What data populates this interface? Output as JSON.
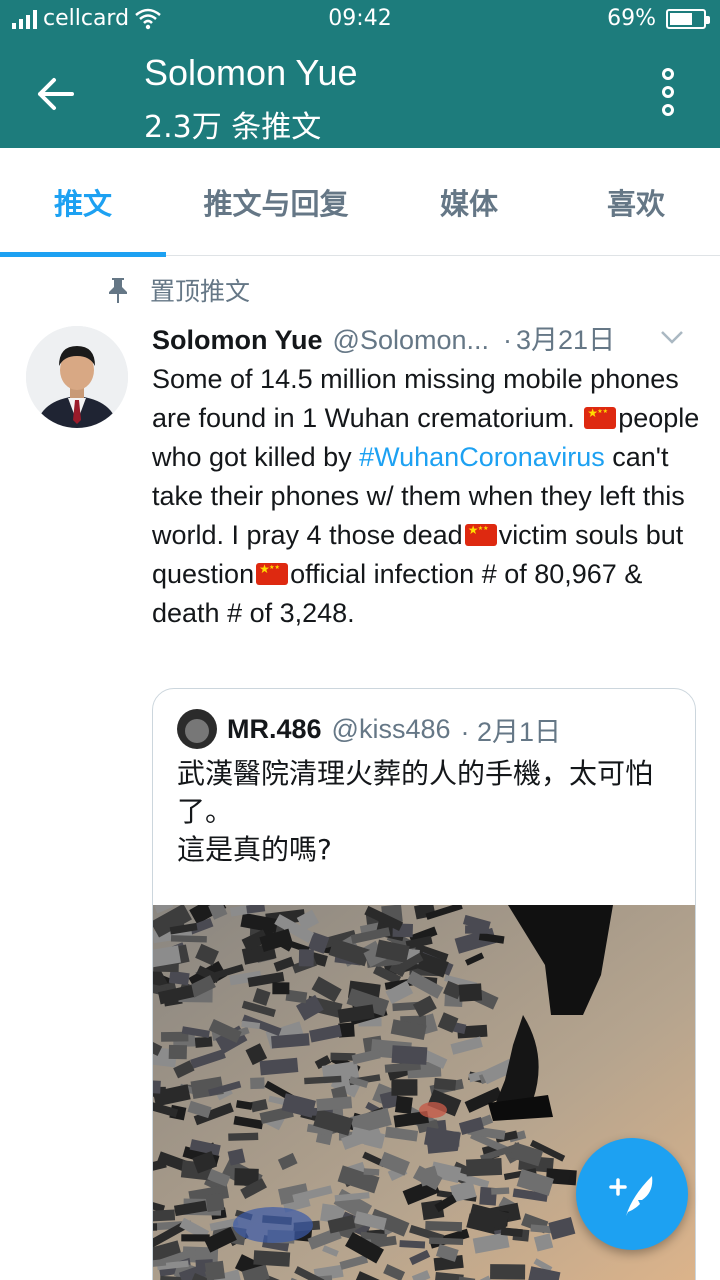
{
  "status_bar": {
    "carrier": "cellcard",
    "time": "09:42",
    "battery": "69%",
    "battery_level": 0.69
  },
  "app_bar": {
    "title": "Solomon Yue",
    "subtitle": "2.3万 条推文"
  },
  "tabs": [
    {
      "label": "推文",
      "active": true
    },
    {
      "label": "推文与回复",
      "active": false
    },
    {
      "label": "媒体",
      "active": false
    },
    {
      "label": "喜欢",
      "active": false
    }
  ],
  "pinned_label": "置顶推文",
  "tweet": {
    "name": "Solomon Yue",
    "handle": "@Solomon...",
    "dot": "·",
    "date": "3月21日",
    "text_1": "Some of 14.5 million missing mobile phones are found in 1 Wuhan crematorium. ",
    "text_2": "people who got killed by ",
    "hashtag": "#WuhanCoronavirus",
    "text_3": " can't take their phones w/ them when they left this world. I pray 4 those dead",
    "text_4": "victim souls but question",
    "text_5": "official infection # of 80,967 & death # of 3,248."
  },
  "quoted_tweet": {
    "name": "MR.486",
    "handle": "@kiss486",
    "date": "· 2月1日",
    "text_line1": "武漢醫院清理火葬的人的手機，太可怕了。",
    "text_line2": "這是真的嗎?"
  },
  "icons": {
    "back": "arrow-left-icon",
    "more": "more-vertical-icon",
    "pin": "pin-icon",
    "caret": "chevron-down-icon",
    "compose": "compose-tweet-icon",
    "flag": "china-flag-emoji"
  },
  "colors": {
    "header_bg": "#1d7c7c",
    "accent": "#1da1f2",
    "secondary_text": "#657786"
  }
}
